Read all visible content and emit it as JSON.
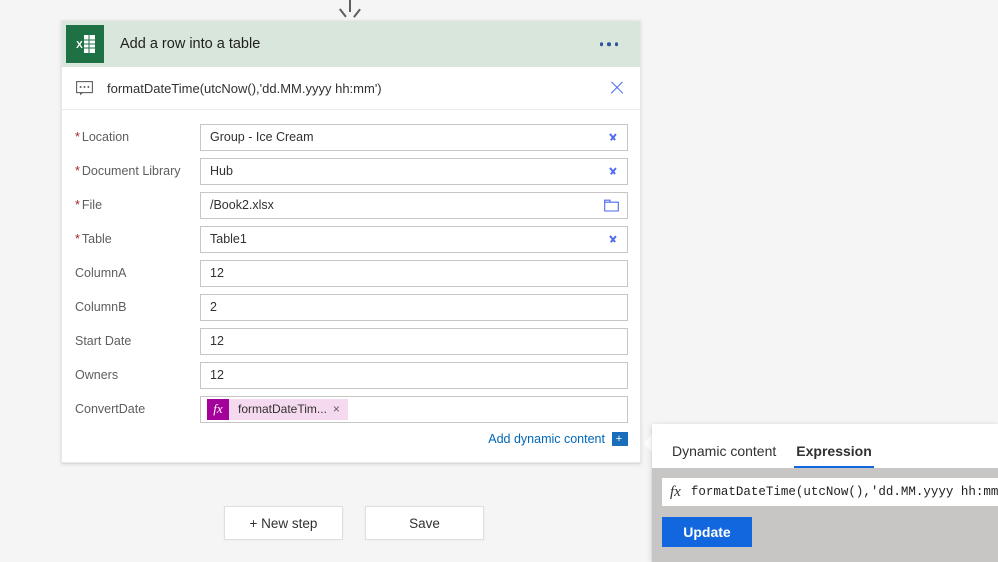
{
  "card": {
    "icon": "excel-icon",
    "title": "Add a row into a table",
    "menu_icon": "ellipsis-icon",
    "expression_tooltip": {
      "icon": "comment-icon",
      "text": "formatDateTime(utcNow(),'dd.MM.yyyy hh:mm')",
      "close_icon": "close-icon"
    },
    "fields": [
      {
        "label": "Location",
        "required": true,
        "value": "Group - Ice Cream",
        "control": "dropdown",
        "icon": "chevron-down-icon"
      },
      {
        "label": "Document Library",
        "required": true,
        "value": "Hub",
        "control": "dropdown",
        "icon": "chevron-down-icon"
      },
      {
        "label": "File",
        "required": true,
        "value": "/Book2.xlsx",
        "control": "file-picker",
        "icon": "folder-icon"
      },
      {
        "label": "Table",
        "required": true,
        "value": "Table1",
        "control": "dropdown",
        "icon": "chevron-down-icon"
      },
      {
        "label": "ColumnA",
        "required": false,
        "value": "12",
        "control": "text",
        "icon": ""
      },
      {
        "label": "ColumnB",
        "required": false,
        "value": "2",
        "control": "text",
        "icon": ""
      },
      {
        "label": "Start Date",
        "required": false,
        "value": "12",
        "control": "text",
        "icon": ""
      },
      {
        "label": "Owners",
        "required": false,
        "value": "12",
        "control": "text",
        "icon": ""
      },
      {
        "label": "ConvertDate",
        "required": false,
        "value": "",
        "control": "token",
        "icon": ""
      }
    ],
    "token": {
      "fx_label": "fx",
      "label": "formatDateTim...",
      "remove_icon": "×"
    },
    "dynamic_content": {
      "link": "Add dynamic content",
      "plus": "+"
    }
  },
  "actions": {
    "new_step": "+ New step",
    "save": "Save"
  },
  "flyout": {
    "tabs": [
      {
        "label": "Dynamic content",
        "active": false
      },
      {
        "label": "Expression",
        "active": true
      }
    ],
    "expression_input": {
      "fx_label": "fx",
      "value": "formatDateTime(utcNow(),'dd.MM.yyyy hh:mm')"
    },
    "update_button": "Update"
  },
  "colors": {
    "excel_green": "#1e7145",
    "header_green": "#d8e6dc",
    "accent_blue": "#1267de",
    "link_blue": "#0067b8",
    "token_magenta": "#a4009a",
    "token_pink": "#f5d9ef",
    "required_red": "#a4262c",
    "page_bg": "#f5f5f5"
  }
}
